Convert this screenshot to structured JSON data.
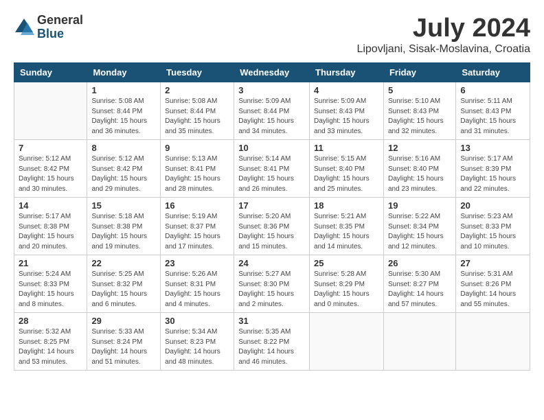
{
  "logo": {
    "general": "General",
    "blue": "Blue"
  },
  "title": "July 2024",
  "location": "Lipovljani, Sisak-Moslavina, Croatia",
  "weekdays": [
    "Sunday",
    "Monday",
    "Tuesday",
    "Wednesday",
    "Thursday",
    "Friday",
    "Saturday"
  ],
  "weeks": [
    [
      {
        "day": "",
        "sunrise": "",
        "sunset": "",
        "daylight": ""
      },
      {
        "day": "1",
        "sunrise": "Sunrise: 5:08 AM",
        "sunset": "Sunset: 8:44 PM",
        "daylight": "Daylight: 15 hours and 36 minutes."
      },
      {
        "day": "2",
        "sunrise": "Sunrise: 5:08 AM",
        "sunset": "Sunset: 8:44 PM",
        "daylight": "Daylight: 15 hours and 35 minutes."
      },
      {
        "day": "3",
        "sunrise": "Sunrise: 5:09 AM",
        "sunset": "Sunset: 8:44 PM",
        "daylight": "Daylight: 15 hours and 34 minutes."
      },
      {
        "day": "4",
        "sunrise": "Sunrise: 5:09 AM",
        "sunset": "Sunset: 8:43 PM",
        "daylight": "Daylight: 15 hours and 33 minutes."
      },
      {
        "day": "5",
        "sunrise": "Sunrise: 5:10 AM",
        "sunset": "Sunset: 8:43 PM",
        "daylight": "Daylight: 15 hours and 32 minutes."
      },
      {
        "day": "6",
        "sunrise": "Sunrise: 5:11 AM",
        "sunset": "Sunset: 8:43 PM",
        "daylight": "Daylight: 15 hours and 31 minutes."
      }
    ],
    [
      {
        "day": "7",
        "sunrise": "Sunrise: 5:12 AM",
        "sunset": "Sunset: 8:42 PM",
        "daylight": "Daylight: 15 hours and 30 minutes."
      },
      {
        "day": "8",
        "sunrise": "Sunrise: 5:12 AM",
        "sunset": "Sunset: 8:42 PM",
        "daylight": "Daylight: 15 hours and 29 minutes."
      },
      {
        "day": "9",
        "sunrise": "Sunrise: 5:13 AM",
        "sunset": "Sunset: 8:41 PM",
        "daylight": "Daylight: 15 hours and 28 minutes."
      },
      {
        "day": "10",
        "sunrise": "Sunrise: 5:14 AM",
        "sunset": "Sunset: 8:41 PM",
        "daylight": "Daylight: 15 hours and 26 minutes."
      },
      {
        "day": "11",
        "sunrise": "Sunrise: 5:15 AM",
        "sunset": "Sunset: 8:40 PM",
        "daylight": "Daylight: 15 hours and 25 minutes."
      },
      {
        "day": "12",
        "sunrise": "Sunrise: 5:16 AM",
        "sunset": "Sunset: 8:40 PM",
        "daylight": "Daylight: 15 hours and 23 minutes."
      },
      {
        "day": "13",
        "sunrise": "Sunrise: 5:17 AM",
        "sunset": "Sunset: 8:39 PM",
        "daylight": "Daylight: 15 hours and 22 minutes."
      }
    ],
    [
      {
        "day": "14",
        "sunrise": "Sunrise: 5:17 AM",
        "sunset": "Sunset: 8:38 PM",
        "daylight": "Daylight: 15 hours and 20 minutes."
      },
      {
        "day": "15",
        "sunrise": "Sunrise: 5:18 AM",
        "sunset": "Sunset: 8:38 PM",
        "daylight": "Daylight: 15 hours and 19 minutes."
      },
      {
        "day": "16",
        "sunrise": "Sunrise: 5:19 AM",
        "sunset": "Sunset: 8:37 PM",
        "daylight": "Daylight: 15 hours and 17 minutes."
      },
      {
        "day": "17",
        "sunrise": "Sunrise: 5:20 AM",
        "sunset": "Sunset: 8:36 PM",
        "daylight": "Daylight: 15 hours and 15 minutes."
      },
      {
        "day": "18",
        "sunrise": "Sunrise: 5:21 AM",
        "sunset": "Sunset: 8:35 PM",
        "daylight": "Daylight: 15 hours and 14 minutes."
      },
      {
        "day": "19",
        "sunrise": "Sunrise: 5:22 AM",
        "sunset": "Sunset: 8:34 PM",
        "daylight": "Daylight: 15 hours and 12 minutes."
      },
      {
        "day": "20",
        "sunrise": "Sunrise: 5:23 AM",
        "sunset": "Sunset: 8:33 PM",
        "daylight": "Daylight: 15 hours and 10 minutes."
      }
    ],
    [
      {
        "day": "21",
        "sunrise": "Sunrise: 5:24 AM",
        "sunset": "Sunset: 8:33 PM",
        "daylight": "Daylight: 15 hours and 8 minutes."
      },
      {
        "day": "22",
        "sunrise": "Sunrise: 5:25 AM",
        "sunset": "Sunset: 8:32 PM",
        "daylight": "Daylight: 15 hours and 6 minutes."
      },
      {
        "day": "23",
        "sunrise": "Sunrise: 5:26 AM",
        "sunset": "Sunset: 8:31 PM",
        "daylight": "Daylight: 15 hours and 4 minutes."
      },
      {
        "day": "24",
        "sunrise": "Sunrise: 5:27 AM",
        "sunset": "Sunset: 8:30 PM",
        "daylight": "Daylight: 15 hours and 2 minutes."
      },
      {
        "day": "25",
        "sunrise": "Sunrise: 5:28 AM",
        "sunset": "Sunset: 8:29 PM",
        "daylight": "Daylight: 15 hours and 0 minutes."
      },
      {
        "day": "26",
        "sunrise": "Sunrise: 5:30 AM",
        "sunset": "Sunset: 8:27 PM",
        "daylight": "Daylight: 14 hours and 57 minutes."
      },
      {
        "day": "27",
        "sunrise": "Sunrise: 5:31 AM",
        "sunset": "Sunset: 8:26 PM",
        "daylight": "Daylight: 14 hours and 55 minutes."
      }
    ],
    [
      {
        "day": "28",
        "sunrise": "Sunrise: 5:32 AM",
        "sunset": "Sunset: 8:25 PM",
        "daylight": "Daylight: 14 hours and 53 minutes."
      },
      {
        "day": "29",
        "sunrise": "Sunrise: 5:33 AM",
        "sunset": "Sunset: 8:24 PM",
        "daylight": "Daylight: 14 hours and 51 minutes."
      },
      {
        "day": "30",
        "sunrise": "Sunrise: 5:34 AM",
        "sunset": "Sunset: 8:23 PM",
        "daylight": "Daylight: 14 hours and 48 minutes."
      },
      {
        "day": "31",
        "sunrise": "Sunrise: 5:35 AM",
        "sunset": "Sunset: 8:22 PM",
        "daylight": "Daylight: 14 hours and 46 minutes."
      },
      {
        "day": "",
        "sunrise": "",
        "sunset": "",
        "daylight": ""
      },
      {
        "day": "",
        "sunrise": "",
        "sunset": "",
        "daylight": ""
      },
      {
        "day": "",
        "sunrise": "",
        "sunset": "",
        "daylight": ""
      }
    ]
  ]
}
